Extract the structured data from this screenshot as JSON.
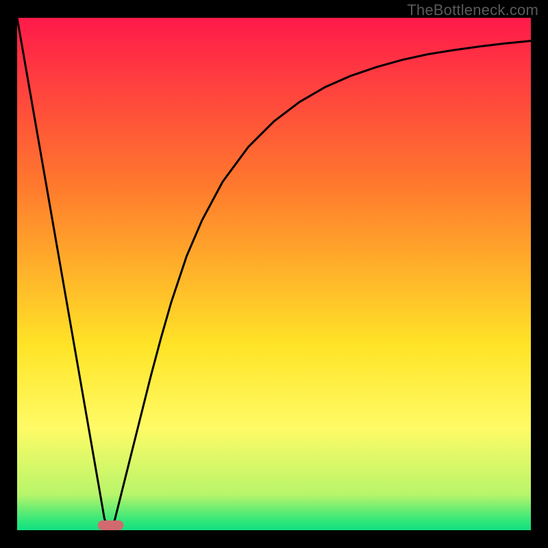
{
  "watermark": "TheBottleneck.com",
  "chart_data": {
    "type": "line",
    "title": "",
    "xlabel": "",
    "ylabel": "",
    "xlim": [
      0,
      100
    ],
    "ylim": [
      0,
      100
    ],
    "grid": false,
    "legend": false,
    "background": {
      "type": "vertical-gradient",
      "stops": [
        {
          "pos": 0.0,
          "color": "#ff1a4a"
        },
        {
          "pos": 0.33,
          "color": "#ff7a2d"
        },
        {
          "pos": 0.64,
          "color": "#ffe427"
        },
        {
          "pos": 0.8,
          "color": "#fffb66"
        },
        {
          "pos": 0.93,
          "color": "#b8f56a"
        },
        {
          "pos": 0.985,
          "color": "#28e67a"
        },
        {
          "pos": 1.0,
          "color": "#14df83"
        }
      ]
    },
    "series": [
      {
        "name": "bottleneck-curve",
        "color": "#000000",
        "x": [
          0,
          2,
          4,
          6,
          8,
          10,
          12,
          14,
          16,
          17,
          18,
          19,
          20,
          22,
          24,
          26,
          28,
          30,
          33,
          36,
          40,
          45,
          50,
          55,
          60,
          65,
          70,
          75,
          80,
          85,
          90,
          95,
          100
        ],
        "y": [
          100,
          88.5,
          77,
          65.5,
          54,
          42.5,
          31,
          19.5,
          8,
          2.2,
          0,
          2,
          6,
          14,
          22,
          30,
          37.5,
          44.5,
          53.5,
          60.5,
          68,
          74.8,
          79.8,
          83.6,
          86.5,
          88.7,
          90.4,
          91.8,
          92.9,
          93.7,
          94.4,
          95.0,
          95.5
        ]
      }
    ],
    "marker": {
      "shape": "rounded-rect",
      "x_center": 18.2,
      "y": 0,
      "width_pct": 5.0,
      "height_pct": 1.9,
      "color": "#d06a6f"
    }
  }
}
